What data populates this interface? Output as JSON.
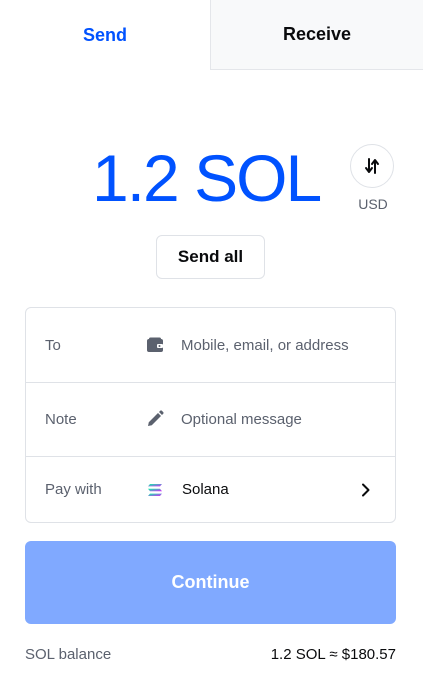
{
  "tabs": [
    {
      "label": "Send",
      "active": true
    },
    {
      "label": "Receive",
      "active": false
    }
  ],
  "amount": {
    "display": "1.2 SOL",
    "toggle_currency": "USD",
    "swap_icon": "swap-vertical-arrows-icon"
  },
  "send_all_label": "Send all",
  "form": {
    "to": {
      "label": "To",
      "icon": "wallet-icon",
      "placeholder": "Mobile, email, or address",
      "value": ""
    },
    "note": {
      "label": "Note",
      "icon": "pencil-icon",
      "placeholder": "Optional message",
      "value": ""
    },
    "pay_with": {
      "label": "Pay with",
      "icon": "solana-icon",
      "value": "Solana",
      "chevron": "chevron-right-icon"
    }
  },
  "continue_label": "Continue",
  "balance": {
    "label": "SOL balance",
    "value": "1.2 SOL ≈ $180.57"
  },
  "colors": {
    "accent": "#0052ff",
    "continue_disabled": "#80a9ff",
    "muted_text": "#5b616e",
    "border": "#dfe2e7"
  }
}
